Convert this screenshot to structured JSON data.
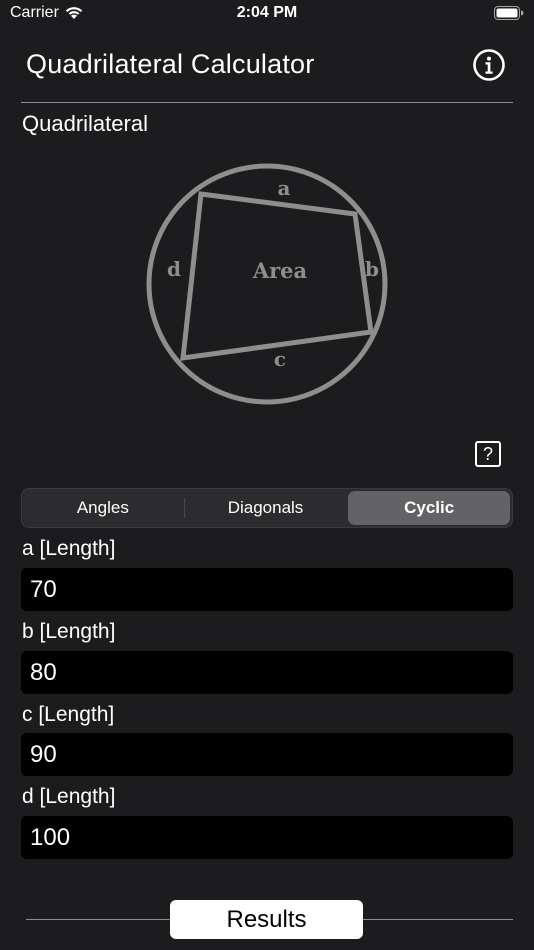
{
  "status_bar": {
    "carrier": "Carrier",
    "time": "2:04 PM",
    "wifi_icon": "wifi-icon",
    "battery_icon": "battery-full-icon"
  },
  "header": {
    "title": "Quadrilateral Calculator",
    "info_icon": "info-circle-icon"
  },
  "section": {
    "title": "Quadrilateral"
  },
  "diagram": {
    "labels": {
      "a": "a",
      "b": "b",
      "c": "c",
      "d": "d",
      "area": "Area"
    },
    "stroke_color": "#8e8e8e"
  },
  "help": {
    "label": "?"
  },
  "tabs": [
    {
      "label": "Angles",
      "selected": false
    },
    {
      "label": "Diagonals",
      "selected": false
    },
    {
      "label": "Cyclic",
      "selected": true
    }
  ],
  "fields": [
    {
      "label": "a [Length]",
      "value": "70"
    },
    {
      "label": "b [Length]",
      "value": "80"
    },
    {
      "label": "c [Length]",
      "value": "90"
    },
    {
      "label": "d [Length]",
      "value": "100"
    }
  ],
  "actions": {
    "results_label": "Results"
  },
  "colors": {
    "background": "#1c1c1e",
    "input_background": "#000000",
    "selected_segment": "#636366",
    "text": "#ffffff"
  }
}
